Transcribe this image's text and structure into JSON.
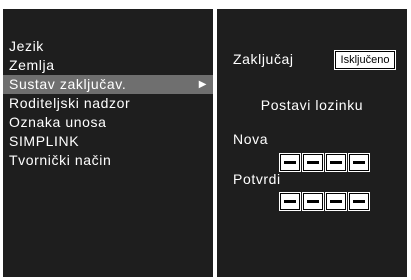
{
  "menu": {
    "items": [
      {
        "label": "Jezik"
      },
      {
        "label": "Zemlja"
      },
      {
        "label": "Sustav zaključav.",
        "arrow": "▶"
      },
      {
        "label": "Roditeljski nadzor"
      },
      {
        "label": "Oznaka unosa"
      },
      {
        "label": "SIMPLINK"
      },
      {
        "label": "Tvornički način"
      }
    ],
    "selected_index": 2
  },
  "lock": {
    "label": "Zaključaj",
    "value": "Isključeno"
  },
  "password": {
    "title": "Postavi lozinku",
    "new_label": "Nova",
    "confirm_label": "Potvrdi"
  },
  "colors": {
    "panel_bg": "#1e1e1e",
    "selected_bg": "#6f6f6f",
    "text": "#ffffff"
  }
}
